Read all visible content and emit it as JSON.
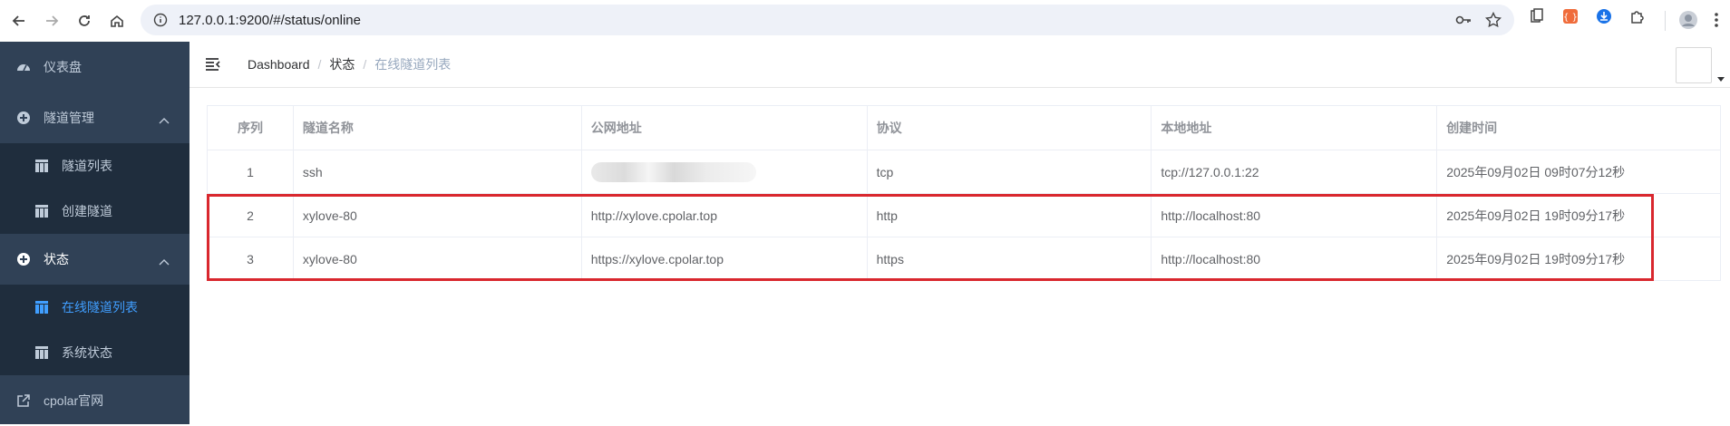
{
  "browser": {
    "url": "127.0.0.1:9200/#/status/online"
  },
  "sidebar": {
    "items": [
      {
        "label": "仪表盘",
        "icon": "dashboard-icon"
      },
      {
        "label": "隧道管理",
        "icon": "tunnel-management-icon",
        "sub": [
          {
            "label": "隧道列表",
            "icon": "table-icon"
          },
          {
            "label": "创建隧道",
            "icon": "table-icon"
          }
        ]
      },
      {
        "label": "状态",
        "icon": "status-icon",
        "sub": [
          {
            "label": "在线隧道列表",
            "icon": "table-icon",
            "active": true
          },
          {
            "label": "系统状态",
            "icon": "table-icon"
          }
        ]
      },
      {
        "label": "cpolar官网",
        "icon": "external-link-icon"
      }
    ]
  },
  "breadcrumb": [
    "Dashboard",
    "状态",
    "在线隧道列表"
  ],
  "table": {
    "columns": [
      "序列",
      "隧道名称",
      "公网地址",
      "协议",
      "本地地址",
      "创建时间"
    ],
    "rows": [
      {
        "index": "1",
        "name": "ssh",
        "public": "",
        "protocol": "tcp",
        "local": "tcp://127.0.0.1:22",
        "created": "2025年09月02日 09时07分12秒"
      },
      {
        "index": "2",
        "name": "xylove-80",
        "public": "http://xylove.cpolar.top",
        "protocol": "http",
        "local": "http://localhost:80",
        "created": "2025年09月02日 19时09分17秒"
      },
      {
        "index": "3",
        "name": "xylove-80",
        "public": "https://xylove.cpolar.top",
        "protocol": "https",
        "local": "http://localhost:80",
        "created": "2025年09月02日 19时09分17秒"
      }
    ]
  },
  "colors": {
    "sidebar_bg": "#304156",
    "submenu_bg": "#1f2d3d",
    "active": "#409eff",
    "highlight": "#d9272e"
  }
}
